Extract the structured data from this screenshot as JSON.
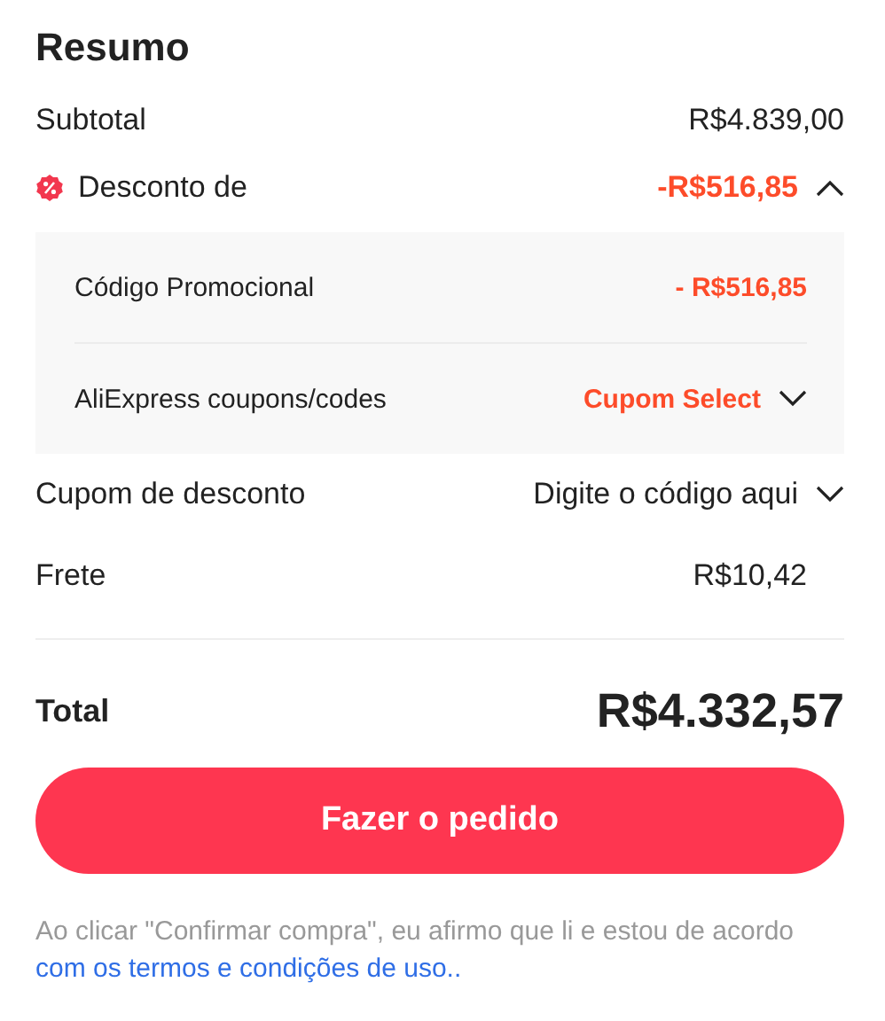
{
  "title": "Resumo",
  "subtotal": {
    "label": "Subtotal",
    "value": "R$4.839,00"
  },
  "discount": {
    "label": "Desconto de",
    "value": "-R$516,85",
    "expanded": true,
    "items": [
      {
        "label": "Código Promocional",
        "value": "- R$516,85",
        "kind": "amount"
      },
      {
        "label": "AliExpress coupons/codes",
        "value": "Cupom Select",
        "kind": "dropdown"
      }
    ]
  },
  "coupon": {
    "label": "Cupom de desconto",
    "action": "Digite o código aqui"
  },
  "shipping": {
    "label": "Frete",
    "value": "R$10,42"
  },
  "total": {
    "label": "Total",
    "value": "R$4.332,57"
  },
  "button": "Fazer o pedido",
  "disclaimer": {
    "text": "Ao clicar \"Confirmar compra\", eu afirmo que li e estou de acordo ",
    "link": "com os termos e condições de uso.."
  }
}
